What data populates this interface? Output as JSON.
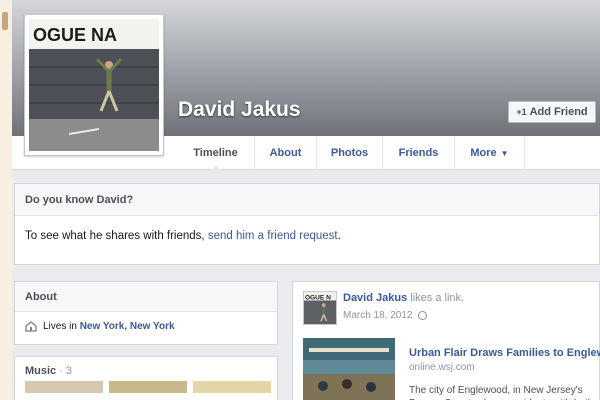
{
  "profile": {
    "name": "David Jakus",
    "add_friend_label": "Add Friend",
    "cover_sign_text": "OGUE NA"
  },
  "nav": {
    "tabs": [
      {
        "label": "Timeline",
        "active": true
      },
      {
        "label": "About"
      },
      {
        "label": "Photos"
      },
      {
        "label": "Friends"
      },
      {
        "label": "More"
      }
    ]
  },
  "know_card": {
    "title": "Do you know David?",
    "body_text": "To see what he shares with friends, ",
    "link_text": "send him a friend request",
    "suffix": "."
  },
  "about": {
    "title": "About",
    "lives_prefix": "Lives in ",
    "lives_link": "New York, New York"
  },
  "music": {
    "title": "Music",
    "count": "· 3"
  },
  "post": {
    "author": "David Jakus",
    "action": " likes a link.",
    "date": "March 18, 2012",
    "thumb_text": "OGUE N",
    "link": {
      "title": "Urban Flair Draws Families to Englewood",
      "domain": "online.wsj.com",
      "description": "The city of Englewood, in New Jersey's Bergen County, draws residents with both its proximity to New York"
    }
  },
  "colors": {
    "link_blue": "#3b5998",
    "page_bg": "#e9ebee",
    "card_head_bg": "#f6f7f9"
  }
}
